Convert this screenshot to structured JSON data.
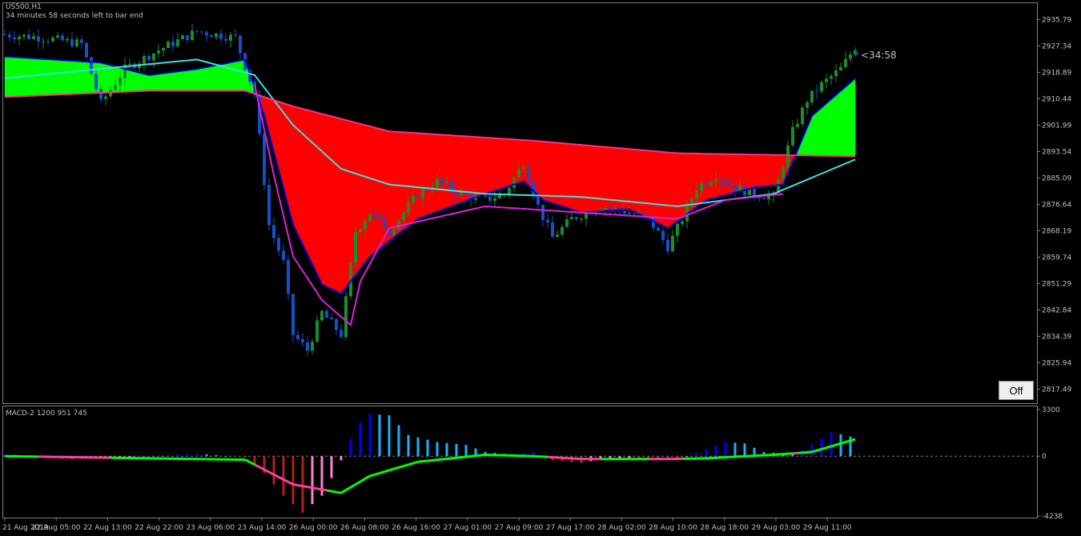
{
  "symbol_label": "US500,H1",
  "countdown_note": "34 minutes 58 seconds left to bar end",
  "countdown_marker": "<34:58",
  "off_button": "Off",
  "macd_label": "MACD-2 1200 951 745",
  "colors": {
    "background": "#000000",
    "axis_text": "#c0c0c0",
    "bull_candle": "#1a8e2e",
    "bear_candle": "#1450c8",
    "cloud_up": "#00ff00",
    "cloud_down": "#ff0000",
    "ma_fast": "#0000cc",
    "ma_cyan": "#40e0e0",
    "ma_magenta": "#e020e0",
    "ma_slow": "#ff3080",
    "macd_bull": "#0000ff",
    "macd_bull_light": "#1ab0ff",
    "macd_bear": "#b02020",
    "macd_bear_light": "#ff80d0"
  },
  "chart_data": [
    {
      "type": "candlestick",
      "y_ticks": [
        "2935.79",
        "2927.34",
        "2918.89",
        "2910.44",
        "2901.99",
        "2893.54",
        "2885.09",
        "2876.64",
        "2868.19",
        "2859.74",
        "2851.29",
        "2842.84",
        "2834.39",
        "2825.94",
        "2817.49"
      ],
      "ylim": [
        2814.0,
        2940.0
      ],
      "x_labels": [
        "21 Aug 2019",
        "22 Aug 05:00",
        "22 Aug 13:00",
        "22 Aug 22:00",
        "23 Aug 06:00",
        "23 Aug 14:00",
        "26 Aug 00:00",
        "26 Aug 08:00",
        "26 Aug 16:00",
        "27 Aug 01:00",
        "27 Aug 09:00",
        "27 Aug 17:00",
        "28 Aug 02:00",
        "28 Aug 10:00",
        "28 Aug 18:00",
        "29 Aug 03:00",
        "29 Aug 11:00"
      ],
      "close_anchors": [
        [
          0,
          2931
        ],
        [
          8,
          2930
        ],
        [
          16,
          2928
        ],
        [
          20,
          2909
        ],
        [
          25,
          2920
        ],
        [
          32,
          2926
        ],
        [
          40,
          2932
        ],
        [
          48,
          2930
        ],
        [
          52,
          2912
        ],
        [
          55,
          2870
        ],
        [
          58,
          2858
        ],
        [
          60,
          2835
        ],
        [
          63,
          2830
        ],
        [
          66,
          2842
        ],
        [
          70,
          2835
        ],
        [
          73,
          2868
        ],
        [
          76,
          2874
        ],
        [
          80,
          2868
        ],
        [
          86,
          2880
        ],
        [
          90,
          2884
        ],
        [
          95,
          2880
        ],
        [
          100,
          2878
        ],
        [
          104,
          2880
        ],
        [
          108,
          2890
        ],
        [
          111,
          2876
        ],
        [
          114,
          2866
        ],
        [
          118,
          2872
        ],
        [
          124,
          2876
        ],
        [
          130,
          2874
        ],
        [
          134,
          2872
        ],
        [
          138,
          2863
        ],
        [
          141,
          2872
        ],
        [
          144,
          2882
        ],
        [
          148,
          2886
        ],
        [
          152,
          2882
        ],
        [
          156,
          2880
        ],
        [
          160,
          2879
        ],
        [
          164,
          2900
        ],
        [
          167,
          2910
        ],
        [
          170,
          2915
        ],
        [
          174,
          2920
        ],
        [
          177,
          2927
        ]
      ],
      "moving_averages": [
        {
          "name": "fast",
          "anchors": [
            [
              0,
              2924
            ],
            [
              20,
              2922
            ],
            [
              30,
              2918
            ],
            [
              40,
              2920
            ],
            [
              50,
              2923
            ],
            [
              54,
              2905
            ],
            [
              60,
              2870
            ],
            [
              66,
              2851
            ],
            [
              70,
              2848
            ],
            [
              76,
              2860
            ],
            [
              86,
              2872
            ],
            [
              100,
              2880
            ],
            [
              108,
              2884
            ],
            [
              112,
              2878
            ],
            [
              120,
              2874
            ],
            [
              130,
              2875
            ],
            [
              138,
              2869
            ],
            [
              146,
              2878
            ],
            [
              156,
              2882
            ],
            [
              162,
              2883
            ],
            [
              168,
              2905
            ],
            [
              177,
              2917
            ]
          ]
        },
        {
          "name": "cyan",
          "anchors": [
            [
              0,
              2917
            ],
            [
              20,
              2920
            ],
            [
              40,
              2923
            ],
            [
              52,
              2918
            ],
            [
              60,
              2902
            ],
            [
              70,
              2888
            ],
            [
              80,
              2883
            ],
            [
              100,
              2880
            ],
            [
              120,
              2879
            ],
            [
              140,
              2876
            ],
            [
              160,
              2880
            ],
            [
              177,
              2891
            ]
          ]
        },
        {
          "name": "magenta",
          "anchors": [
            [
              52,
              2915
            ],
            [
              56,
              2886
            ],
            [
              60,
              2860
            ],
            [
              66,
              2846
            ],
            [
              72,
              2838
            ],
            [
              74,
              2852
            ],
            [
              80,
              2869
            ],
            [
              100,
              2876
            ],
            [
              120,
              2874
            ],
            [
              140,
              2872
            ],
            [
              150,
              2878
            ],
            [
              162,
              2880
            ]
          ]
        },
        {
          "name": "slow",
          "anchors": [
            [
              0,
              2911
            ],
            [
              30,
              2913
            ],
            [
              50,
              2913
            ],
            [
              60,
              2908
            ],
            [
              80,
              2900
            ],
            [
              110,
              2897
            ],
            [
              140,
              2893
            ],
            [
              177,
              2892
            ]
          ]
        }
      ]
    },
    {
      "type": "histogram",
      "y_ticks": [
        "3300",
        "0",
        "-4238"
      ],
      "ylim": [
        -4238,
        3300
      ],
      "histogram_anchors": [
        [
          0,
          150
        ],
        [
          12,
          -200
        ],
        [
          20,
          -150
        ],
        [
          30,
          80
        ],
        [
          40,
          200
        ],
        [
          50,
          -100
        ],
        [
          54,
          -1200
        ],
        [
          58,
          -2800
        ],
        [
          62,
          -4000
        ],
        [
          66,
          -2800
        ],
        [
          70,
          -300
        ],
        [
          72,
          1200
        ],
        [
          75,
          3000
        ],
        [
          80,
          2900
        ],
        [
          84,
          1500
        ],
        [
          90,
          1000
        ],
        [
          96,
          800
        ],
        [
          100,
          300
        ],
        [
          106,
          100
        ],
        [
          110,
          350
        ],
        [
          114,
          -300
        ],
        [
          120,
          -500
        ],
        [
          124,
          -200
        ],
        [
          130,
          -150
        ],
        [
          140,
          -300
        ],
        [
          146,
          500
        ],
        [
          150,
          1000
        ],
        [
          154,
          900
        ],
        [
          158,
          300
        ],
        [
          164,
          150
        ],
        [
          167,
          600
        ],
        [
          172,
          1700
        ],
        [
          176,
          1400
        ],
        [
          177,
          1300
        ]
      ],
      "signal_anchors": [
        [
          0,
          0
        ],
        [
          50,
          -250
        ],
        [
          60,
          -2000
        ],
        [
          70,
          -2600
        ],
        [
          76,
          -1400
        ],
        [
          86,
          -400
        ],
        [
          100,
          100
        ],
        [
          110,
          0
        ],
        [
          120,
          -200
        ],
        [
          138,
          -200
        ],
        [
          146,
          -150
        ],
        [
          160,
          100
        ],
        [
          168,
          300
        ],
        [
          177,
          1200
        ]
      ]
    }
  ]
}
